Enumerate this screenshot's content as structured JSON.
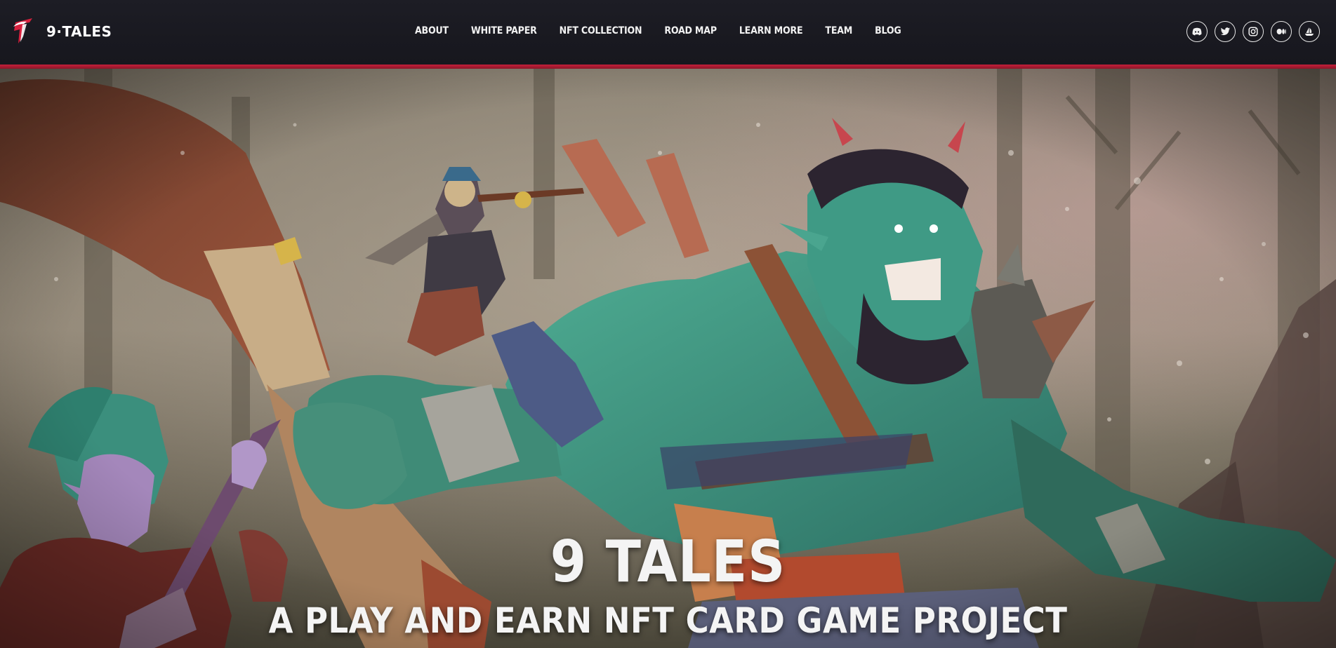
{
  "brand": {
    "name": "9·TALES",
    "logo_icon": "phoenix-t-logo",
    "accent_color": "#c4203a"
  },
  "nav": {
    "items": [
      {
        "label": "ABOUT"
      },
      {
        "label": "WHITE PAPER"
      },
      {
        "label": "NFT COLLECTION"
      },
      {
        "label": "ROAD MAP"
      },
      {
        "label": "LEARN MORE"
      },
      {
        "label": "TEAM"
      },
      {
        "label": "BLOG"
      }
    ]
  },
  "socials": [
    {
      "icon": "discord-icon"
    },
    {
      "icon": "twitter-icon"
    },
    {
      "icon": "instagram-icon"
    },
    {
      "icon": "medium-icon"
    },
    {
      "icon": "opensea-icon"
    }
  ],
  "hero": {
    "title": "9 TALES",
    "subtitle": "A PLAY AND EARN NFT CARD GAME PROJECT"
  }
}
